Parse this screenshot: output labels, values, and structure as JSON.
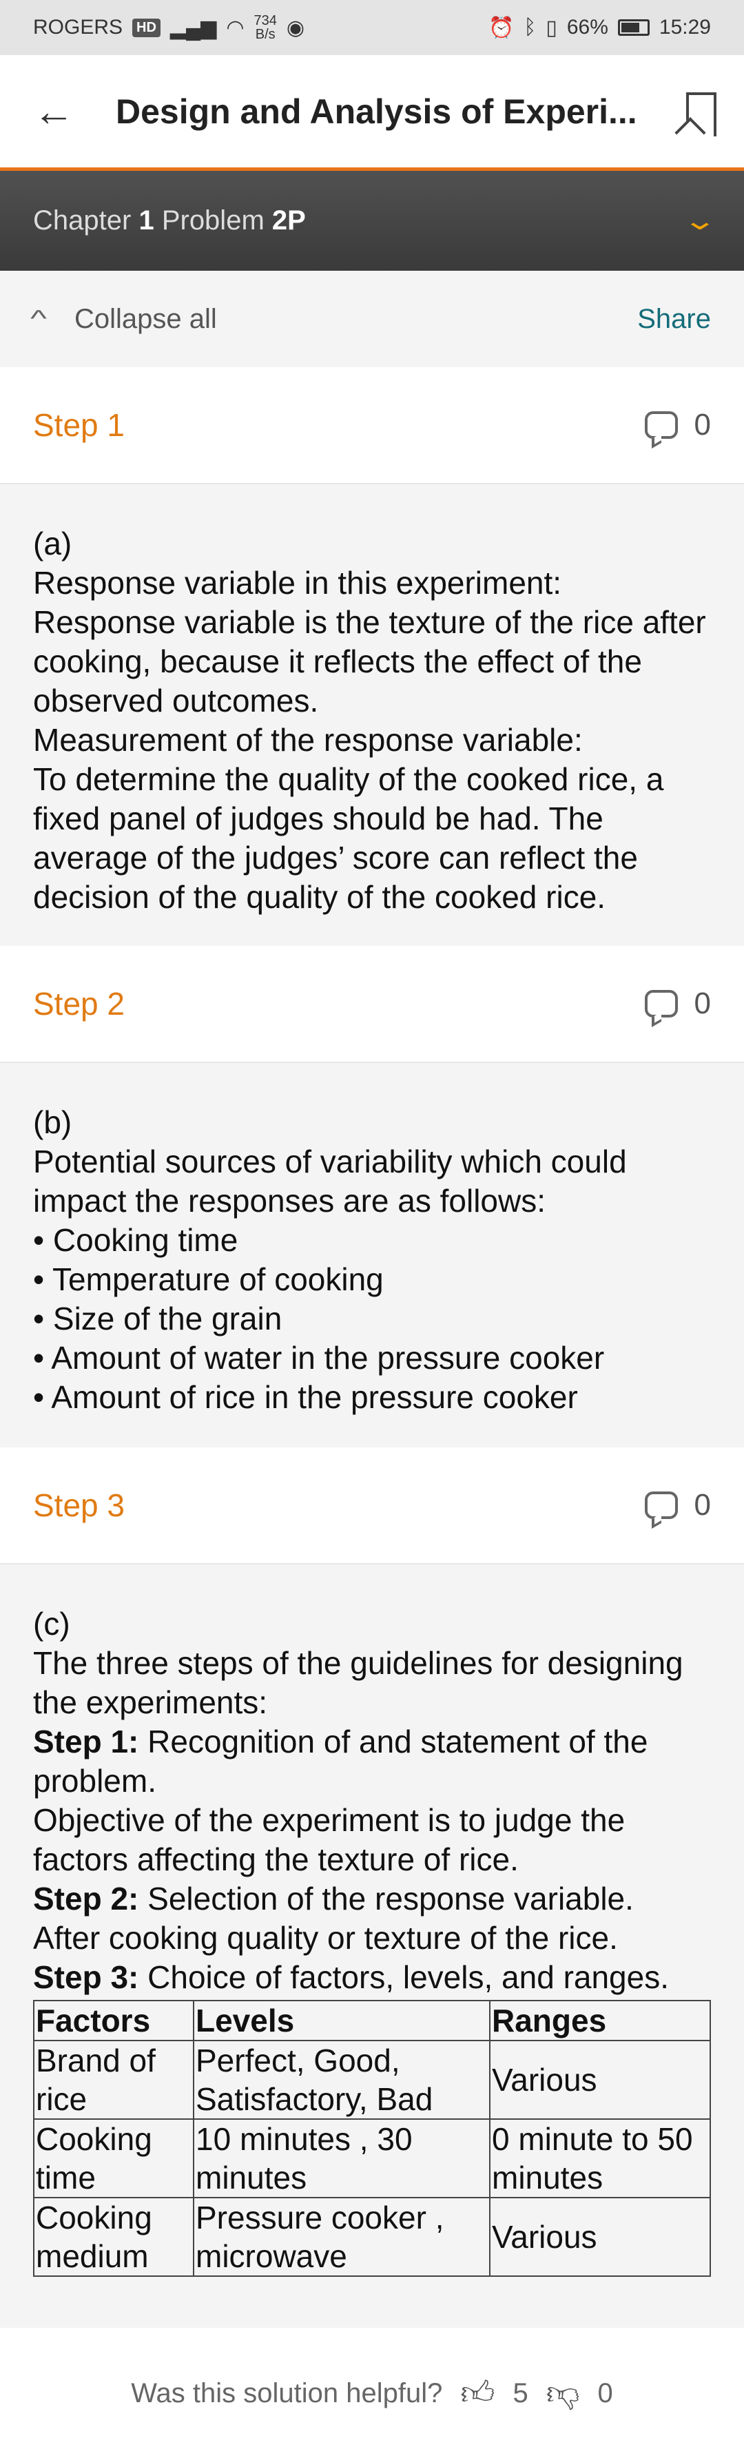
{
  "status_bar": {
    "carrier": "ROGERS",
    "hd": "HD",
    "rate_value": "734",
    "rate_unit": "B/s",
    "battery": "66%",
    "time": "15:29"
  },
  "app_bar": {
    "title": "Design and Analysis of Experi..."
  },
  "chapter_bar": {
    "chapter_label": "Chapter",
    "chapter_num": "1",
    "problem_label": "Problem",
    "problem_num": "2P"
  },
  "controls": {
    "collapse_label": "Collapse all",
    "share_label": "Share"
  },
  "steps": [
    {
      "title": "Step 1",
      "comments": "0",
      "lines": [
        "(a)",
        "Response variable in this experiment:",
        "Response variable is the texture of the rice after cooking, because it reflects the effect of the observed outcomes.",
        "Measurement of the response variable:",
        "To determine the quality of the cooked rice, a fixed panel of judges should be had. The average of the judges’ score can reflect the decision of the quality of the cooked rice."
      ]
    },
    {
      "title": "Step 2",
      "comments": "0",
      "lines": [
        "(b)",
        "Potential sources of variability which could impact the responses are as follows:",
        "• Cooking time",
        "• Temperature of cooking",
        "• Size of the grain",
        "• Amount of water in the pressure cooker",
        "• Amount of rice in the pressure cooker"
      ]
    },
    {
      "title": "Step 3",
      "comments": "0",
      "intro": [
        "(c)",
        "The three steps of the guidelines for designing the experiments:"
      ],
      "s1_label": "Step 1:",
      "s1_text": " Recognition of and statement of the problem.",
      "s1_detail": "Objective of the experiment is to judge the factors affecting the texture of rice.",
      "s2_label": "Step 2:",
      "s2_text": " Selection of the response variable.",
      "s2_detail": "After cooking quality or texture of the rice.",
      "s3_label": "Step 3:",
      "s3_text": " Choice of factors, levels, and ranges.",
      "table": {
        "headers": [
          "Factors",
          "Levels",
          "Ranges"
        ],
        "rows": [
          [
            "Brand of rice",
            "Perfect, Good, Satisfactory, Bad",
            "Various"
          ],
          [
            "Cooking time",
            "10 minutes , 30 minutes",
            "0 minute to 50 minutes"
          ],
          [
            "Cooking medium",
            "Pressure cooker , microwave",
            "Various"
          ]
        ]
      }
    }
  ],
  "footer": {
    "question": "Was this solution helpful?",
    "likes": "5",
    "dislikes": "0"
  }
}
